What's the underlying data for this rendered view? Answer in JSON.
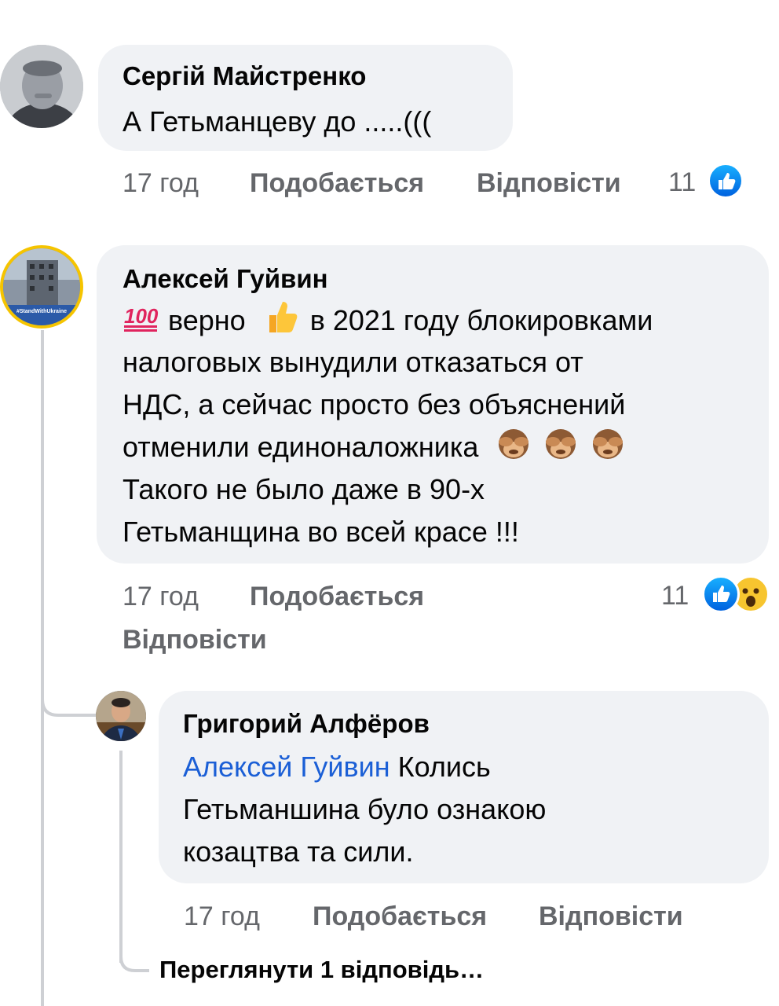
{
  "comments": [
    {
      "author": "Сергій Майстренко",
      "text": "А Гетьманцеву до .....(((",
      "time": "17 год",
      "like_label": "Подобається",
      "reply_label": "Відповісти",
      "reaction_count": "11",
      "reactions": [
        "like-icon"
      ]
    },
    {
      "author": "Алексей Гуйвин",
      "avatar_badge": "#StandWithUkraine",
      "lines": [
        "верно",
        "в 2021 году блокировками",
        "налоговых вынудили отказаться от",
        "НДС, а сейчас просто без объяснений",
        "отменили единоналожника",
        "Такого не было даже в 90-х",
        "Гетьманщина во всей красе !!!"
      ],
      "emojis": [
        "hundred-points-icon",
        "thumbs-up-icon",
        "see-no-evil-monkey-icon"
      ],
      "time": "17 год",
      "like_label": "Подобається",
      "reply_label": "Відповісти",
      "reaction_count": "11",
      "reactions": [
        "like-icon",
        "wow-icon"
      ]
    }
  ],
  "reply": {
    "author": "Григорий Алфёров",
    "mention": "Алексей Гуйвин",
    "line1_rest": "Колись",
    "line2": "Гетьманшина було ознакою",
    "line3": "козацтва та сили.",
    "time": "17 год",
    "like_label": "Подобається",
    "reply_label": "Відповісти"
  },
  "view_replies_label": "Переглянути 1 відповідь…",
  "colors": {
    "bubble": "#f0f2f5",
    "meta_text": "#65676b",
    "mention": "#1b5fd6",
    "like_blue": "#1877f2",
    "thread_line": "#ced0d4"
  }
}
